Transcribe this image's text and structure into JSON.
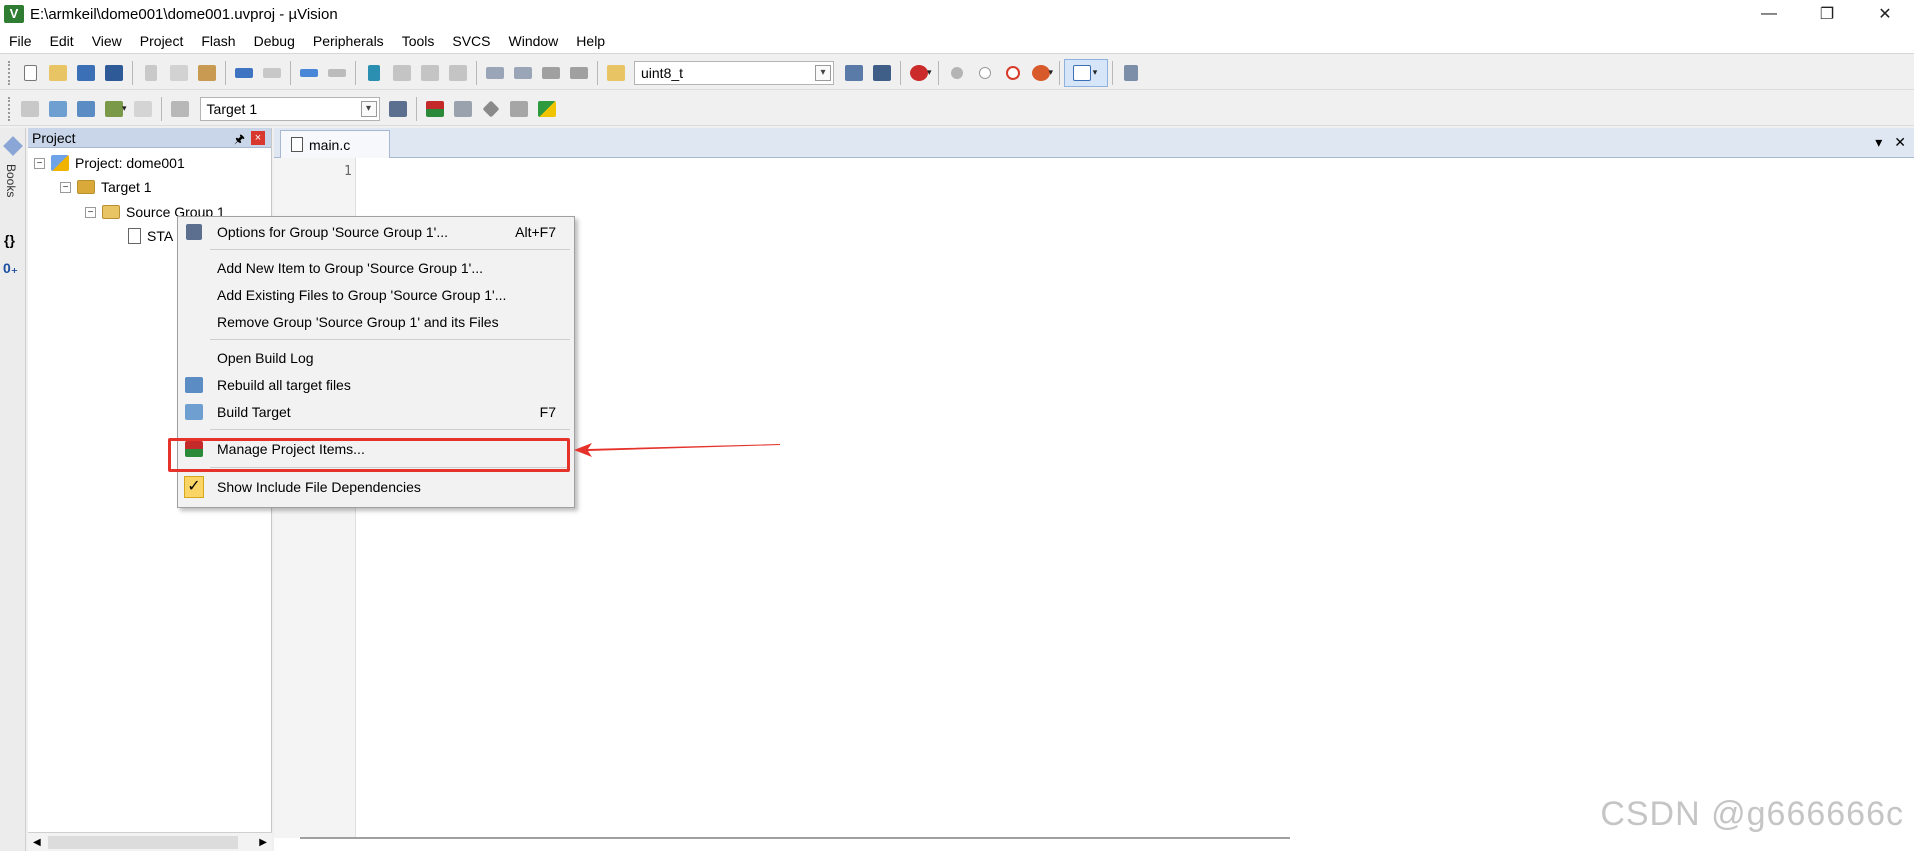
{
  "window": {
    "title": "E:\\armkeil\\dome001\\dome001.uvproj - µVision",
    "app_icon": "V",
    "minimize": "—",
    "restore": "❐",
    "close": "✕"
  },
  "menu": [
    "File",
    "Edit",
    "View",
    "Project",
    "Flash",
    "Debug",
    "Peripherals",
    "Tools",
    "SVCS",
    "Window",
    "Help"
  ],
  "toolbar": {
    "find_combo_value": "uint8_t",
    "target_combo_value": "Target 1",
    "dropdown_glyph": "▾"
  },
  "left_strip": {
    "books_label": "Books",
    "functions_label": "{}",
    "templates_label": "0₊"
  },
  "project_panel": {
    "title": "Project",
    "pin": "🖈",
    "close": "×",
    "tree": {
      "project": "Project: dome001",
      "target": "Target 1",
      "group": "Source Group 1",
      "file": "STA"
    },
    "expander": "−"
  },
  "editor": {
    "tab": "main.c",
    "line_number": "1",
    "menu_glyph": "▾",
    "close_glyph": "✕"
  },
  "context_menu": {
    "options": {
      "label": "Options for Group 'Source Group 1'...",
      "shortcut": "Alt+F7"
    },
    "add_new": "Add New  Item to Group 'Source Group 1'...",
    "add_existing": "Add Existing Files to Group 'Source Group 1'...",
    "remove_group": "Remove Group 'Source Group 1' and its Files",
    "open_build_log": "Open Build Log",
    "rebuild": "Rebuild all target files",
    "build": {
      "label": "Build Target",
      "shortcut": "F7"
    },
    "manage": "Manage Project Items...",
    "show_include": "Show Include File Dependencies",
    "checkmark": "✓"
  },
  "annotation": {
    "highlight_color": "#e5322a"
  },
  "watermark": "CSDN @g666666c"
}
